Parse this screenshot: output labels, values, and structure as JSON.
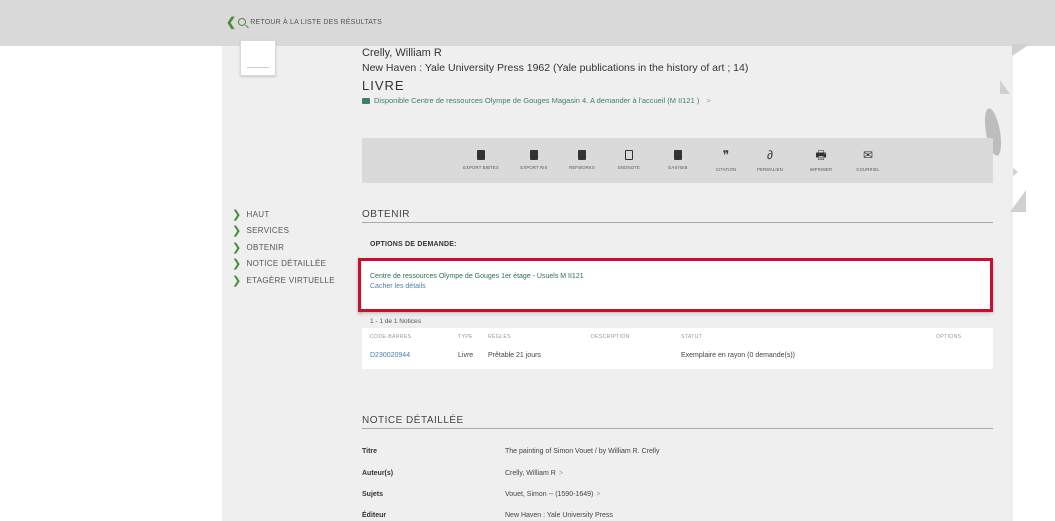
{
  "topbar": {
    "back_label": "RETOUR À LA LISTE DES RÉSULTATS"
  },
  "record": {
    "author": "Crelly, William R",
    "publication": "New Haven : Yale University Press 1962 (Yale publications in the history of art ; 14)",
    "type": "LIVRE",
    "availability": "Disponible Centre de ressources Olympe de Gouges  Magasin 4. A demander à l'accueil (M II121 )",
    "availability_arrow": ">"
  },
  "actions": [
    {
      "label": "EXPORT BIBTEX",
      "icon": "export-bibtex-icon"
    },
    {
      "label": "EXPORT RIS",
      "icon": "export-ris-icon"
    },
    {
      "label": "REFWORKS",
      "icon": "refworks-icon"
    },
    {
      "label": "ENDNOTE",
      "icon": "endnote-icon"
    },
    {
      "label": "EASYBIB",
      "icon": "easybib-icon"
    },
    {
      "label": "CITATION",
      "icon": "quote-icon",
      "glyph": "❞"
    },
    {
      "label": "PERMALIEN",
      "icon": "link-icon",
      "glyph": "∂"
    },
    {
      "label": "IMPRIMER",
      "icon": "printer-icon",
      "glyph": "🖶"
    },
    {
      "label": "COURRIEL",
      "icon": "mail-icon",
      "glyph": "✉"
    }
  ],
  "sidenav": [
    {
      "label": "HAUT"
    },
    {
      "label": "SERVICES"
    },
    {
      "label": "OBTENIR"
    },
    {
      "label": "NOTICE DÉTAILLÉE"
    },
    {
      "label": "ETAGÈRE VIRTUELLE"
    }
  ],
  "obtenir": {
    "title": "OBTENIR",
    "options_label": "OPTIONS DE DEMANDE:",
    "location": "Centre de ressources Olympe de Gouges  1er étage - Usuels  M II121",
    "hide_details": "Cacher les détails",
    "count": "1 - 1 de 1 Notices",
    "columns": [
      "CODE-BARRES",
      "TYPE",
      "RÈGLES",
      "DESCRIPTION",
      "STATUT",
      "OPTIONS"
    ],
    "row": {
      "barcode": "D230020944",
      "type": "Livre",
      "rules": "Prêtable 21 jours",
      "description": "",
      "status": "Exemplaire en rayon (0 demande(s))",
      "options": ""
    }
  },
  "notice": {
    "title": "NOTICE DÉTAILLÉE",
    "fields": [
      {
        "label": "Titre",
        "value": "The painting of Simon Vouet / by William R. Crelly",
        "arrow": ""
      },
      {
        "label": "Auteur(s)",
        "value": "Crelly, William R",
        "arrow": ">"
      },
      {
        "label": "Sujets",
        "value": "Vouet, Simon -- (1590-1649)",
        "arrow": ">"
      },
      {
        "label": "Éditeur",
        "value": "New Haven : Yale University Press",
        "arrow": ""
      }
    ]
  }
}
